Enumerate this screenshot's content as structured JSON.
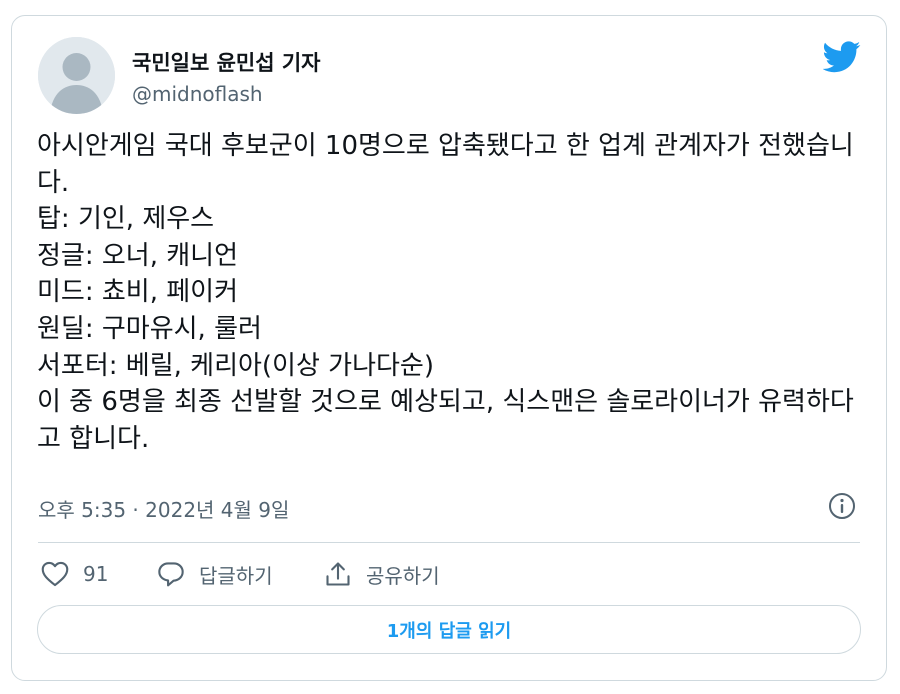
{
  "tweet": {
    "display_name": "국민일보 윤민섭 기자",
    "handle": "@midnoflash",
    "text": "아시안게임 국대 후보군이 10명으로 압축됐다고 한 업계 관계자가 전했습니다.\n탑: 기인, 제우스\n정글: 오너, 캐니언\n미드: 쵸비, 페이커\n원딜: 구마유시, 룰러\n서포터: 베릴, 케리아(이상 가나다순)\n이 중 6명을 최종 선발할 것으로 예상되고, 식스맨은 솔로라이너가 유력하다고 합니다.",
    "timestamp": "오후 5:35 · 2022년 4월 9일"
  },
  "actions": {
    "like_count": "91",
    "reply_label": "답글하기",
    "share_label": "공유하기"
  },
  "read_replies_label": "1개의 답글 읽기",
  "colors": {
    "brand_blue": "#1d9bf0",
    "secondary_text": "#536471",
    "border": "#cfd9de"
  },
  "icons": {
    "logo": "twitter-bird-icon",
    "info": "info-icon",
    "like": "heart-icon",
    "reply": "reply-bubble-icon",
    "share": "share-upload-icon"
  }
}
